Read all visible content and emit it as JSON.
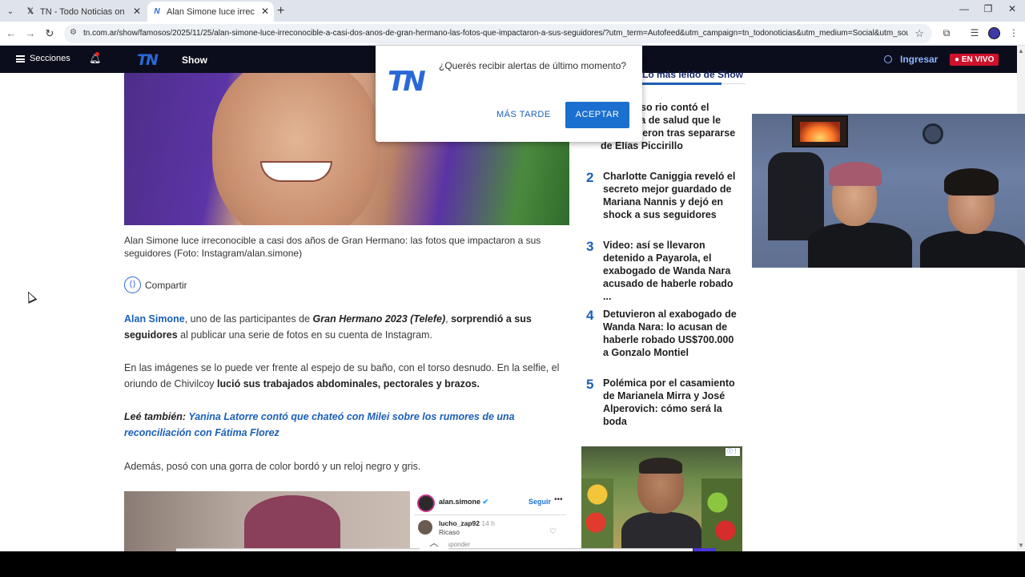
{
  "browser": {
    "tabs": [
      {
        "title": "TN - Todo Noticias on X: \"Alan",
        "favicon": "x-logo"
      },
      {
        "title": "Alan Simone luce irreconocible",
        "favicon": "tn-logo"
      }
    ],
    "new_tab_symbol": "+",
    "url": "tn.com.ar/show/famosos/2025/11/25/alan-simone-luce-irreconocible-a-casi-dos-anos-de-gran-hermano-las-fotos-que-impactaron-a-sus-seguidores/?utm_term=Autofeed&utm_campaign=tn_todonoticias&utm_medium=Social&utm_source=Twitt..."
  },
  "site_header": {
    "secciones_label": "Secciones",
    "logo_text": "TN",
    "section_label": "Show",
    "login_label": "Ingresar",
    "live_label": "● EN VIVO"
  },
  "popup": {
    "question": "¿Querés recibir alertas de último momento?",
    "later_label": "MÁS TARDE",
    "accept_label": "ACEPTAR",
    "logo_text": "TN"
  },
  "article": {
    "caption": "Alan Simone luce irreconocible a casi dos años de Gran Hermano: las fotos que impactaron a sus seguidores (Foto: Instagram/alan.simone)",
    "share_label": "Compartir",
    "p1": {
      "link": "Alan Simone",
      "t1": ", uno de las participantes de ",
      "italic": "Gran Hermano 2023 (Telefe)",
      "t2": ", ",
      "bold": "sorprendió a sus seguidores",
      "t3": " al publicar una serie de fotos en su cuenta de Instagram."
    },
    "p2": {
      "t1": "En las imágenes se lo puede ver frente al espejo de su baño, con el torso desnudo. En la selfie, el oriundo de Chivilcoy ",
      "bold": "lució sus trabajados abdominales, pectorales y brazos."
    },
    "p3": {
      "lead": "Leé también:",
      "link": " Yanina Latorre contó que chateó con Milei sobre los rumores de una reconciliación con Fátima Florez"
    },
    "p4": "Además, posó con una gorra de color bordó y un reloj negro y gris.",
    "instagram": {
      "user": "alan.simone",
      "verified": "✔",
      "follow": "Seguir",
      "more": "•••",
      "commenter": "lucho_zap92",
      "comment_time": "14 h",
      "comment": "Ricaso",
      "reply": "Responder"
    }
  },
  "sidebar": {
    "title": "Lo más leído de Show",
    "items": [
      {
        "num": "1",
        "text": "Un famoso rio contó el problema de salud que le descubrieron tras separarse de Elías Piccirillo"
      },
      {
        "num": "2",
        "text": "Charlotte Caniggia reveló el secreto mejor guardado de Mariana Nannis y dejó en shock a sus seguidores"
      },
      {
        "num": "3",
        "text": "Video: así se llevaron detenido a Payarola, el exabogado de Wanda Nara acusado de haberle robado ..."
      },
      {
        "num": "4",
        "text": "Detuvieron al exabogado de Wanda Nara: lo acusan de haberle robado US$700.000 a Gonzalo Montiel"
      },
      {
        "num": "5",
        "text": "Polémica por el casamiento de Marianela Mirra y José Alperovich: cómo será la boda"
      }
    ]
  },
  "colors": {
    "accent": "#1b5fb8",
    "header_bg": "#0b0d1c",
    "live_red": "#d0112b",
    "button_blue": "#1b6fce"
  }
}
